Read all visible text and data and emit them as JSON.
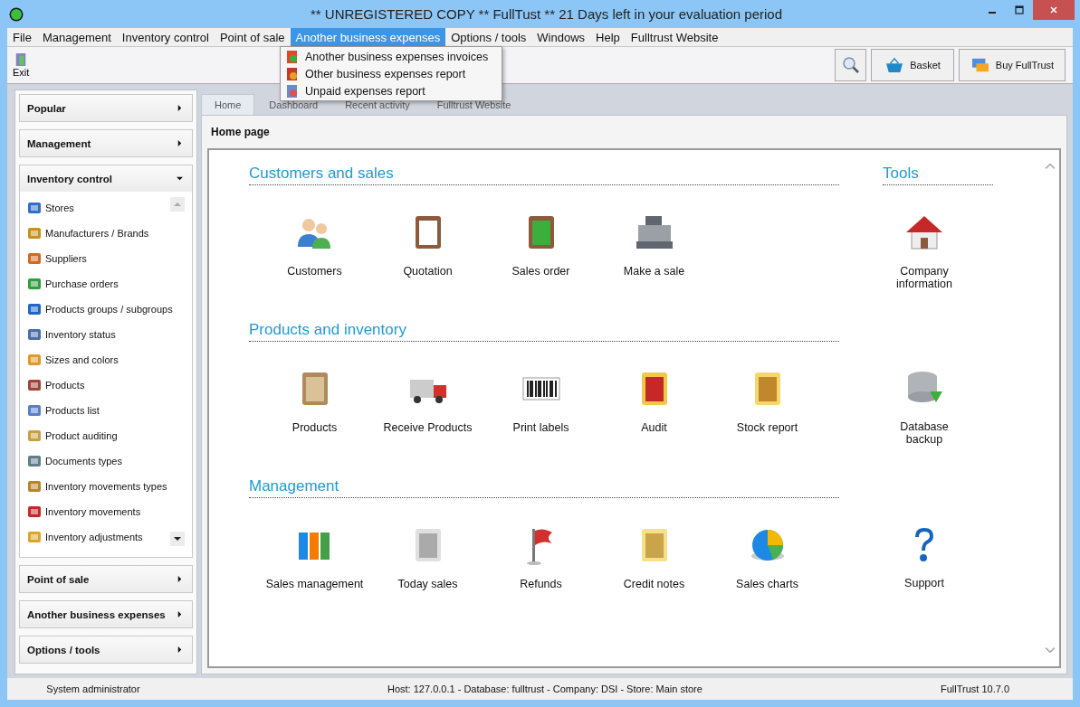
{
  "window": {
    "title": "** UNREGISTERED COPY ** FullTust ** 21 Days left in your evaluation period"
  },
  "menu": [
    {
      "label": "File",
      "selected": false
    },
    {
      "label": "Management",
      "selected": false
    },
    {
      "label": "Inventory control",
      "selected": false
    },
    {
      "label": "Point of sale",
      "selected": false
    },
    {
      "label": "Another business expenses",
      "selected": true
    },
    {
      "label": "Options / tools",
      "selected": false
    },
    {
      "label": "Windows",
      "selected": false
    },
    {
      "label": "Help",
      "selected": false
    },
    {
      "label": "Fulltrust Website",
      "selected": false
    }
  ],
  "dropdown": [
    "Another business expenses invoices",
    "Other business expenses report",
    "Unpaid expenses report"
  ],
  "toolbar": {
    "exit": "Exit",
    "basket": "Basket",
    "buy": "Buy FullTrust"
  },
  "sidebar": [
    {
      "label": "Popular",
      "expanded": false
    },
    {
      "label": "Management",
      "expanded": false
    },
    {
      "label": "Inventory control",
      "expanded": true,
      "items": [
        "Stores",
        "Manufacturers / Brands",
        "Suppliers",
        "Purchase orders",
        "Products groups / subgroups",
        "Inventory status",
        "Sizes and colors",
        "Products",
        "Products list",
        "Product auditing",
        "Documents types",
        "Inventory movements types",
        "Inventory movements",
        "Inventory adjustments"
      ]
    },
    {
      "label": "Point of sale",
      "expanded": false
    },
    {
      "label": "Another business expenses",
      "expanded": false
    },
    {
      "label": "Options / tools",
      "expanded": false
    }
  ],
  "tabs": [
    {
      "label": "Home",
      "selected": true
    },
    {
      "label": "Dashboard",
      "selected": false
    },
    {
      "label": "Recent activity",
      "selected": false
    },
    {
      "label": "Fulltrust Website",
      "selected": false
    }
  ],
  "page_title": "Home page",
  "sections": [
    {
      "title": "Customers and sales",
      "tiles": [
        "Customers",
        "Quotation",
        "Sales order",
        "Make a sale"
      ],
      "tools": {
        "title": "Tools",
        "tiles": [
          "Company information"
        ]
      }
    },
    {
      "title": "Products and inventory",
      "tiles": [
        "Products",
        "Receive Products",
        "Print labels",
        "Audit",
        "Stock report"
      ],
      "tools": {
        "tiles": [
          "Database backup"
        ]
      }
    },
    {
      "title": "Management",
      "tiles": [
        "Sales management",
        "Today sales",
        "Refunds",
        "Credit notes",
        "Sales charts"
      ],
      "tools": {
        "tiles": [
          "Support"
        ]
      }
    }
  ],
  "status_bar": {
    "user": "System administrator",
    "connection": "Host: 127.0.0.1 - Database: fulltrust - Company: DSI - Store: Main store",
    "version": "FullTrust 10.7.0"
  }
}
